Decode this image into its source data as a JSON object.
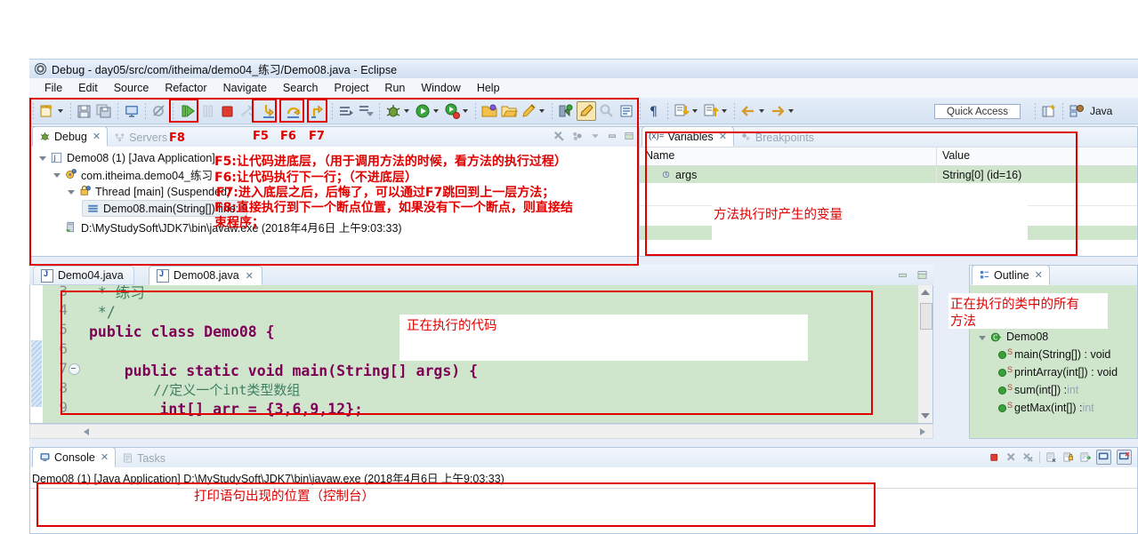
{
  "window": {
    "title": "Debug - day05/src/com/itheima/demo04_练习/Demo08.java - Eclipse",
    "logo_icon": "eclipse-logo-icon"
  },
  "menu": {
    "items": [
      "File",
      "Edit",
      "Source",
      "Refactor",
      "Navigate",
      "Search",
      "Project",
      "Run",
      "Window",
      "Help"
    ]
  },
  "toolbar": {
    "quick_access_placeholder": "Quick Access",
    "perspective_label": "Java",
    "icons": [
      "new-wizard-icon",
      "new-dropdown-caret",
      "save-icon",
      "save-all-icon",
      "console-display-icon",
      "skip-breakpoints-icon",
      "resume-icon",
      "suspend-icon",
      "terminate-icon",
      "disconnect-icon",
      "step-into-icon",
      "step-over-icon",
      "step-return-icon",
      "instruction-step-icon",
      "drop-to-frame-icon",
      "debug-icon",
      "debug-caret",
      "run-icon",
      "run-caret",
      "coverage-icon",
      "coverage-caret",
      "new-java-project-icon",
      "open-type-icon",
      "pencil-icon",
      "pencil-caret",
      "external-tools-icon",
      "toggle-markoccurrences-icon",
      "search-icon",
      "show-whitespace-icon",
      "pilcrow-icon",
      "next-annotation-icon",
      "next-caret",
      "previous-annotation-icon",
      "previous-caret",
      "back-icon",
      "back-caret",
      "forward-icon",
      "forward-caret",
      "open-perspective-icon"
    ]
  },
  "debug_view": {
    "tabs": [
      {
        "label": "Debug",
        "active": true,
        "icon": "debug-bug-icon"
      },
      {
        "label": "Servers",
        "active": false,
        "icon": "servers-icon"
      }
    ],
    "toolbar_icons": [
      "remove-all-terminated-icon",
      "view-menu-dots-icon",
      "minimize-view-icon",
      "restore-view-icon",
      "maximize-view-icon"
    ],
    "tree": [
      {
        "indent": 0,
        "label": "Demo08 (1) [Java Application]",
        "icon": "launch-config-icon",
        "expanded": true
      },
      {
        "indent": 1,
        "label": "com.itheima.demo04_练习",
        "icon": "debug-target-icon",
        "expanded": true
      },
      {
        "indent": 2,
        "label": "Thread [main] (Suspended)",
        "icon": "thread-icon",
        "expanded": true
      },
      {
        "indent": 3,
        "label": "Demo08.main(String[]) line: 9",
        "icon": "stack-frame-icon",
        "selected": true
      },
      {
        "indent": 1,
        "label": "D:\\MyStudySoft\\JDK7\\bin\\javaw.exe (2018年4月6日 上午9:03:33)",
        "icon": "process-icon"
      }
    ]
  },
  "variables_view": {
    "tabs": [
      {
        "label": "Variables",
        "active": true,
        "icon": "variables-icon"
      },
      {
        "label": "Breakpoints",
        "active": false,
        "icon": "breakpoints-icon"
      }
    ],
    "columns": [
      "Name",
      "Value"
    ],
    "rows": [
      {
        "name": "args",
        "value": "String[0]  (id=16)",
        "icon": "object-variable-icon"
      }
    ]
  },
  "editor": {
    "tabs": [
      {
        "label": "Demo04.java",
        "active": false,
        "icon": "java-file-icon"
      },
      {
        "label": "Demo08.java",
        "active": true,
        "icon": "java-file-icon"
      }
    ],
    "minimize_icon": "minimize-editor-icon",
    "maximize_icon": "maximize-editor-icon",
    "lines": [
      {
        "num": "3",
        "text": " * 练习",
        "kind": "comment"
      },
      {
        "num": "4",
        "text": " */",
        "kind": "comment"
      },
      {
        "num": "5",
        "text": "public class Demo08 {",
        "kind": "code"
      },
      {
        "num": "6",
        "text": "",
        "kind": "code"
      },
      {
        "num": "7",
        "text": "    public static void main(String[] args) {",
        "kind": "code",
        "fold": true
      },
      {
        "num": "8",
        "text": "        //定义一个int类型数组",
        "kind": "comment"
      },
      {
        "num": "9",
        "text": "        int[] arr = {3,6,9,12};",
        "kind": "code",
        "highlight": true
      }
    ]
  },
  "outline_view": {
    "tabs": [
      {
        "label": "Outline",
        "active": true,
        "icon": "outline-icon"
      }
    ],
    "items": [
      {
        "indent": 0,
        "label": "Demo08",
        "icon": "class-icon",
        "expanded": true
      },
      {
        "indent": 1,
        "label": "main(String[]) : void",
        "type_suffix": "",
        "icon": "method-public-static-icon"
      },
      {
        "indent": 1,
        "label": "printArray(int[]) : void",
        "type_suffix": "",
        "icon": "method-public-static-icon"
      },
      {
        "indent": 1,
        "label": "sum(int[]) : ",
        "type_suffix": "int",
        "icon": "method-public-static-icon"
      },
      {
        "indent": 1,
        "label": "getMax(int[]) : ",
        "type_suffix": "int",
        "icon": "method-public-static-icon"
      }
    ]
  },
  "console_view": {
    "tabs": [
      {
        "label": "Console",
        "active": true,
        "icon": "console-icon"
      },
      {
        "label": "Tasks",
        "active": false,
        "icon": "tasks-icon"
      }
    ],
    "header_line": "Demo08 (1) [Java Application] D:\\MyStudySoft\\JDK7\\bin\\javaw.exe (2018年4月6日 上午9:03:33)",
    "toolbar_icons": [
      "terminate-icon",
      "remove-launch-icon",
      "remove-all-launches-icon",
      "clear-console-icon",
      "scroll-lock-icon",
      "pin-console-icon",
      "display-selected-console-icon",
      "open-console-icon"
    ]
  },
  "annotations": {
    "key_f8": "F8",
    "key_f5": "F5",
    "key_f6": "F6",
    "key_f7": "F7",
    "debug_keys": [
      "F5:让代码进底层，（用于调用方法的时候，看方法的执行过程）",
      "F6:让代码执行下一行；（不进底层）",
      "F7:进入底层之后，后悔了，可以通过F7跳回到上一层方法；",
      "F8:直接执行到下一个断点位置，如果没有下一个断点，则直接结",
      "束程序；"
    ],
    "variables_note": "方法执行时产生的变量",
    "editor_note": "正在执行的代码",
    "outline_note_line1": "正在执行的类中的所有",
    "outline_note_line2": "方法",
    "console_note": "打印语句出现的位置（控制台）"
  },
  "colors": {
    "annotation_red": "#e00000",
    "keyword_purple": "#7f0055",
    "comment_green": "#3f7f5f",
    "debug_row_green": "#cfe6cd",
    "highlight_line": "#d8d8a8"
  }
}
